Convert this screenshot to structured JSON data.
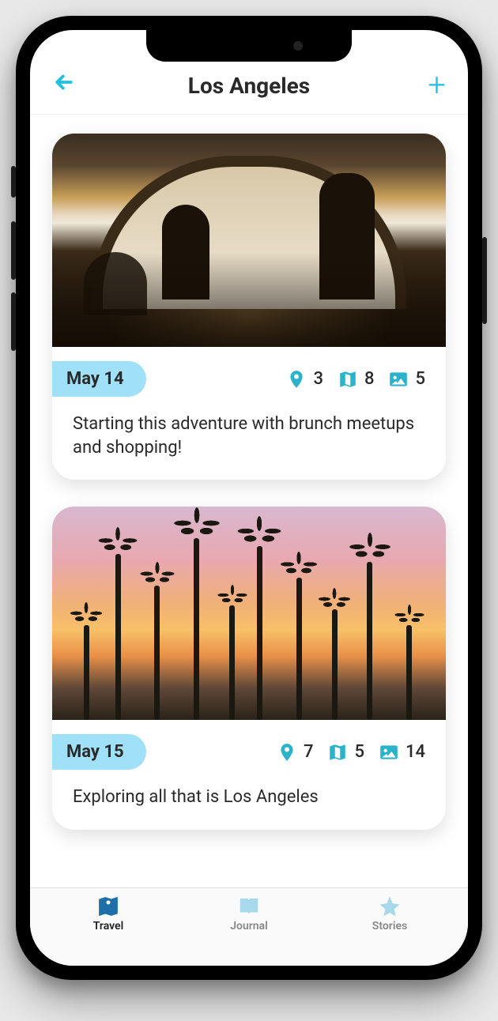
{
  "header": {
    "title": "Los Angeles"
  },
  "entries": [
    {
      "date": "May 14",
      "pins": "3",
      "maps": "8",
      "photos": "5",
      "text": "Starting this adventure with brunch meetups and shopping!"
    },
    {
      "date": "May 15",
      "pins": "7",
      "maps": "5",
      "photos": "14",
      "text": "Exploring all that is Los Angeles"
    }
  ],
  "tabs": {
    "travel": "Travel",
    "journal": "Journal",
    "stories": "Stories"
  },
  "colors": {
    "accent": "#1fc0e0",
    "pillBg": "#a0e0f8",
    "iconTeal": "#2bb3c9",
    "tabInactive": "#a8d8ec",
    "tabActive": "#1e6ea8"
  }
}
